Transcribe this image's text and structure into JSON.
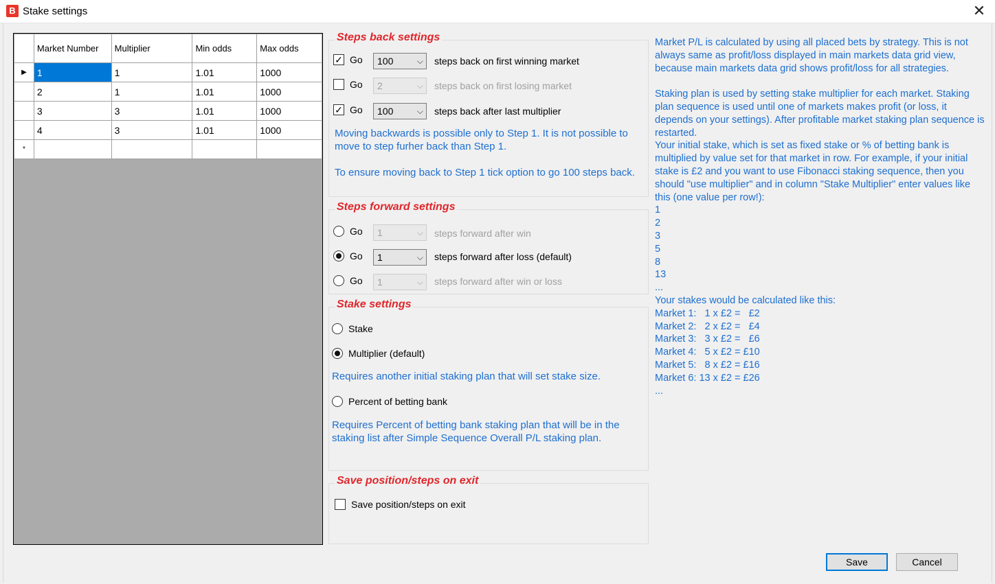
{
  "window": {
    "title": "Stake settings",
    "icon_letter": "B",
    "close_glyph": "✕"
  },
  "grid": {
    "columns": [
      "Market Number",
      "Multiplier",
      "Min odds",
      "Max odds"
    ],
    "rows": [
      [
        "1",
        "1",
        "1.01",
        "1000"
      ],
      [
        "2",
        "1",
        "1.01",
        "1000"
      ],
      [
        "3",
        "3",
        "1.01",
        "1000"
      ],
      [
        "4",
        "3",
        "1.01",
        "1000"
      ]
    ],
    "current_row_marker": "▶",
    "new_row_marker": "*"
  },
  "steps_back": {
    "title": "Steps back settings",
    "go_label": "Go",
    "rows": [
      {
        "checked": true,
        "value": "100",
        "text": "steps back on first winning market",
        "enabled": true
      },
      {
        "checked": false,
        "value": "2",
        "text": "steps back on first losing market",
        "enabled": false
      },
      {
        "checked": true,
        "value": "100",
        "text": "steps back after last multiplier",
        "enabled": true
      }
    ],
    "info1": "Moving backwards is possible only to Step 1. It is not possible to move to step furher back than Step 1.",
    "info2": "To ensure moving back to Step 1 tick option to go 100 steps back."
  },
  "steps_forward": {
    "title": "Steps forward settings",
    "go_label": "Go",
    "rows": [
      {
        "selected": false,
        "value": "1",
        "text": "steps forward after win",
        "enabled": false
      },
      {
        "selected": true,
        "value": "1",
        "text": "steps forward after loss (default)",
        "enabled": true
      },
      {
        "selected": false,
        "value": "1",
        "text": "steps forward after win or loss",
        "enabled": false
      }
    ]
  },
  "stake_settings": {
    "title": "Stake settings",
    "option_stake": "Stake",
    "option_multiplier": "Multiplier (default)",
    "multiplier_info": "Requires another initial staking plan that will set stake size.",
    "option_percent": "Percent of betting bank",
    "percent_info": "Requires Percent of betting bank staking plan that will be in the staking list after Simple Sequence Overall P/L staking plan."
  },
  "save_position": {
    "title": "Save position/steps on exit",
    "checkbox_label": "Save position/steps on exit",
    "checked": false
  },
  "side_info": "Market P/L is calculated by using all placed bets by strategy. This is not always same as profit/loss displayed in main markets data grid view, because main markets data grid shows profit/loss for all strategies.\n\nStaking plan is used by setting stake multiplier for each market. Staking plan sequence is used until one of markets makes profit (or loss, it depends on your settings). After profitable market staking plan sequence is restarted.\nYour initial stake, which is set as fixed stake or % of betting bank is multiplied by value set for that market in row. For example, if your initial stake is £2 and you want to use Fibonacci staking sequence, then you should \"use multiplier\" and in column \"Stake Multiplier\" enter values like this (one value per row!):\n1\n2\n3\n5\n8\n13\n...\nYour stakes would be calculated like this:\nMarket 1:   1 x £2 =   £2\nMarket 2:   2 x £2 =   £4\nMarket 3:   3 x £2 =   £6\nMarket 4:   5 x £2 = £10\nMarket 5:   8 x £2 = £16\nMarket 6: 13 x £2 = £26\n...",
  "buttons": {
    "save": "Save",
    "cancel": "Cancel"
  },
  "colors": {
    "section_title": "#e0262b",
    "info_text": "#1e6fd0",
    "selection": "#0078d7",
    "grid_background": "#ababab"
  },
  "icons": {
    "dropdown": "chevron-down-icon",
    "close": "close-icon"
  }
}
